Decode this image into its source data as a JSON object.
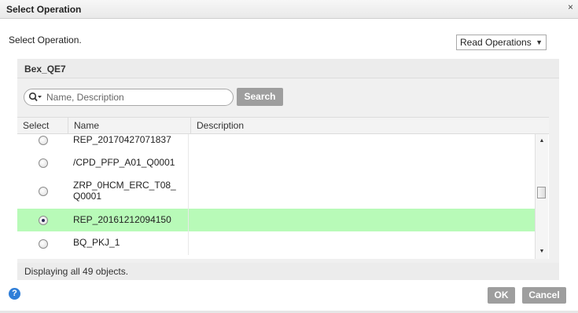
{
  "dialog": {
    "title": "Select Operation",
    "close_glyph": "×",
    "instruction": "Select Operation.",
    "operation_select": {
      "value": "Read Operations",
      "arrow_glyph": "▼"
    }
  },
  "panel": {
    "title": "Bex_QE7",
    "search": {
      "placeholder": "Name, Description",
      "value": "",
      "button_label": "Search"
    }
  },
  "grid": {
    "columns": {
      "select": "Select",
      "name": "Name",
      "description": "Description"
    },
    "rows": [
      {
        "name": "REP_20170427071837",
        "description": "",
        "selected": false
      },
      {
        "name": "/CPD_PFP_A01_Q0001",
        "description": "",
        "selected": false
      },
      {
        "name": "ZRP_0HCM_ERC_T08_\nQ0001",
        "description": "",
        "selected": false
      },
      {
        "name": "REP_20161212094150",
        "description": "",
        "selected": true
      },
      {
        "name": "BQ_PKJ_1",
        "description": "",
        "selected": false
      }
    ],
    "scrollbar": {
      "up_glyph": "▲",
      "down_glyph": "▼"
    }
  },
  "status": "Displaying all 49 objects.",
  "footer": {
    "help_glyph": "?",
    "ok_label": "OK",
    "cancel_label": "Cancel"
  },
  "colors": {
    "selected_row": "#b8fab8",
    "button_bg": "#9e9e9e",
    "help_icon": "#2f7ed8"
  },
  "icons": {
    "close": "close-icon",
    "search": "search-icon",
    "help": "help-icon",
    "dropdown": "chevron-down-icon"
  }
}
